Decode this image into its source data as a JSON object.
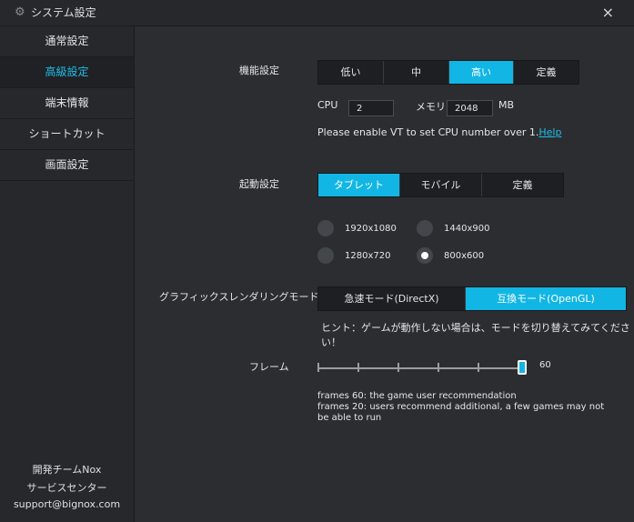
{
  "window": {
    "title": "システム設定",
    "close_label": "×"
  },
  "sidebar": {
    "items": [
      {
        "label": "通常設定"
      },
      {
        "label": "高級設定"
      },
      {
        "label": "端末情報"
      },
      {
        "label": "ショートカット"
      },
      {
        "label": "画面設定"
      }
    ],
    "active_index": 1,
    "footer": {
      "team": "開発チームNox",
      "service": "サービスセンター",
      "email": "support@bignox.com"
    }
  },
  "performance": {
    "label": "機能設定",
    "options": [
      "低い",
      "中",
      "高い",
      "定義"
    ],
    "selected": "高い",
    "cpu_label": "CPU",
    "cpu_value": "2",
    "memory_label": "メモリ",
    "memory_value": "2048",
    "memory_unit": "MB",
    "vt_hint": "Please enable VT to set CPU number over 1.",
    "help_link": "Help"
  },
  "startup": {
    "label": "起動設定",
    "options": [
      "タブレット",
      "モバイル",
      "定義"
    ],
    "selected": "タブレット",
    "resolutions": [
      "1920x1080",
      "1440x900",
      "1280x720",
      "800x600"
    ],
    "selected_resolution": "800x600"
  },
  "graphics": {
    "label": "グラフィックスレンダリングモード",
    "options": [
      "急速モード(DirectX)",
      "互換モード(OpenGL)"
    ],
    "selected": "互換モード(OpenGL)",
    "hint": "ヒント：ゲームが動作しない場合は、モードを切り替えてみてください！"
  },
  "frames": {
    "label": "フレーム",
    "value": "60",
    "notes": [
      "frames 60: the game user recommendation",
      "frames 20: users recommend additional, a few games may not be able to run"
    ]
  },
  "colors": {
    "accent": "#12b6e4",
    "link": "#1ec0ea",
    "panel": "#2b2d31",
    "sidebar": "#26282c"
  },
  "icons": {
    "settings": "gear-icon",
    "close": "close-icon"
  }
}
